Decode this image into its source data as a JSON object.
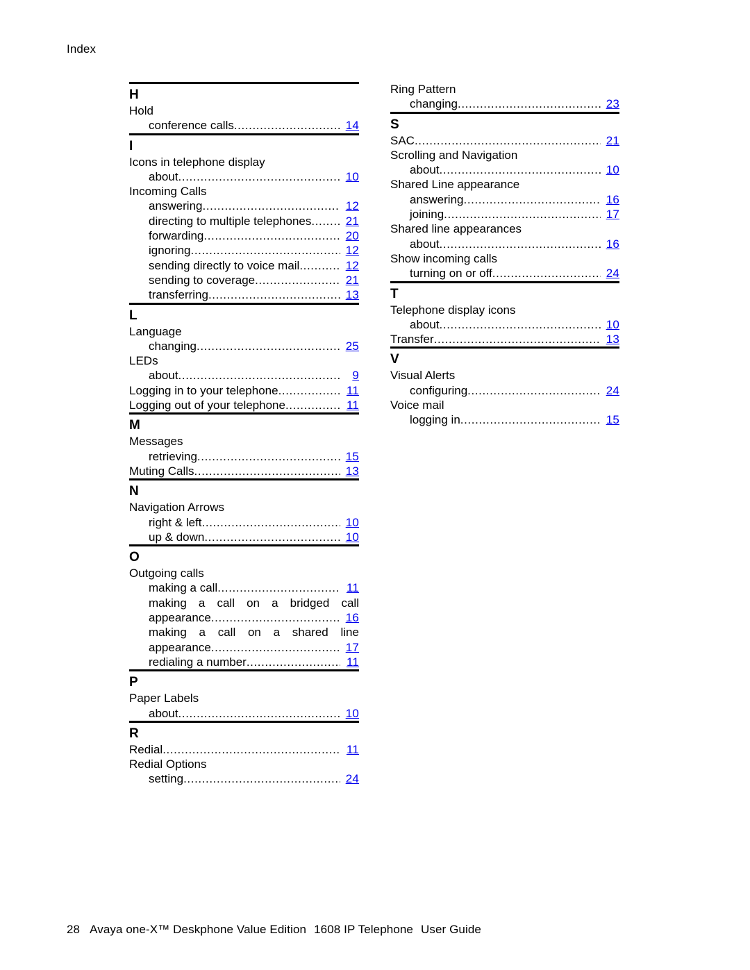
{
  "running_head": "Index",
  "footer": {
    "page_number": "28",
    "product": "Avaya one-X™ Deskphone Value Edition",
    "model": "1608 IP Telephone",
    "doc_type": "User Guide"
  },
  "link_color": "#0000EE",
  "columns": [
    {
      "name": "left-column",
      "sections": [
        {
          "letter": "H",
          "rule_above": true,
          "items": [
            {
              "type": "group",
              "label": "Hold"
            },
            {
              "type": "leader",
              "level": 2,
              "label": "conference calls",
              "page": "14"
            }
          ]
        },
        {
          "letter": "I",
          "rule_above": true,
          "items": [
            {
              "type": "group",
              "label": "Icons in telephone display"
            },
            {
              "type": "leader",
              "level": 2,
              "label": "about",
              "page": "10"
            },
            {
              "type": "group",
              "label": "Incoming Calls"
            },
            {
              "type": "leader",
              "level": 2,
              "label": "answering",
              "page": "12"
            },
            {
              "type": "leader",
              "level": 2,
              "label": "directing to multiple telephones",
              "page": "21"
            },
            {
              "type": "leader",
              "level": 2,
              "label": "forwarding",
              "page": "20"
            },
            {
              "type": "leader",
              "level": 2,
              "label": "ignoring",
              "page": "12"
            },
            {
              "type": "leader",
              "level": 2,
              "label": "sending directly to voice mail",
              "page": "12"
            },
            {
              "type": "leader",
              "level": 2,
              "label": "sending to coverage",
              "page": "21"
            },
            {
              "type": "leader",
              "level": 2,
              "label": "transferring",
              "page": "13"
            }
          ]
        },
        {
          "letter": "L",
          "rule_above": true,
          "items": [
            {
              "type": "group",
              "label": "Language"
            },
            {
              "type": "leader",
              "level": 2,
              "label": "changing",
              "page": "25"
            },
            {
              "type": "group",
              "label": "LEDs"
            },
            {
              "type": "leader",
              "level": 2,
              "label": "about",
              "page": "9"
            },
            {
              "type": "leader",
              "level": 1,
              "label": "Logging in to your telephone",
              "page": "11"
            },
            {
              "type": "leader",
              "level": 1,
              "label": "Logging out of your telephone",
              "page": "11"
            }
          ]
        },
        {
          "letter": "M",
          "rule_above": true,
          "items": [
            {
              "type": "group",
              "label": "Messages"
            },
            {
              "type": "leader",
              "level": 2,
              "label": "retrieving",
              "page": "15"
            },
            {
              "type": "leader",
              "level": 1,
              "label": "Muting Calls",
              "page": "13"
            }
          ]
        },
        {
          "letter": "N",
          "rule_above": true,
          "items": [
            {
              "type": "group",
              "label": "Navigation Arrows"
            },
            {
              "type": "leader",
              "level": 2,
              "label": "right & left",
              "page": "10"
            },
            {
              "type": "leader",
              "level": 2,
              "label": "up & down",
              "page": "10"
            }
          ]
        },
        {
          "letter": "O",
          "rule_above": true,
          "items": [
            {
              "type": "group",
              "label": "Outgoing calls"
            },
            {
              "type": "leader",
              "level": 2,
              "label": "making a call",
              "page": "11"
            },
            {
              "type": "wrap",
              "words": [
                "making",
                "a",
                "call",
                "on",
                "a",
                "bridged",
                "call"
              ]
            },
            {
              "type": "leader",
              "level": 2,
              "label": "appearance",
              "page": "16"
            },
            {
              "type": "wrap",
              "words": [
                "making",
                "a",
                "call",
                "on",
                "a",
                "shared",
                "line"
              ]
            },
            {
              "type": "leader",
              "level": 2,
              "label": "appearance",
              "page": "17"
            },
            {
              "type": "leader",
              "level": 2,
              "label": "redialing a number",
              "page": "11"
            }
          ]
        },
        {
          "letter": "P",
          "rule_above": true,
          "items": [
            {
              "type": "group",
              "label": "Paper Labels"
            },
            {
              "type": "leader",
              "level": 2,
              "label": "about",
              "page": "10"
            }
          ]
        },
        {
          "letter": "R",
          "rule_above": true,
          "items": [
            {
              "type": "leader",
              "level": 1,
              "label": "Redial",
              "page": "11"
            },
            {
              "type": "group",
              "label": "Redial Options"
            },
            {
              "type": "leader",
              "level": 2,
              "label": "setting",
              "page": "24"
            }
          ]
        }
      ]
    },
    {
      "name": "right-column",
      "sections": [
        {
          "letter": "",
          "rule_above": false,
          "items": [
            {
              "type": "group",
              "label": "Ring Pattern"
            },
            {
              "type": "leader",
              "level": 2,
              "label": "changing",
              "page": "23"
            }
          ]
        },
        {
          "letter": "S",
          "rule_above": true,
          "items": [
            {
              "type": "leader",
              "level": 1,
              "label": "SAC",
              "page": "21"
            },
            {
              "type": "group",
              "label": "Scrolling and Navigation"
            },
            {
              "type": "leader",
              "level": 2,
              "label": "about",
              "page": "10"
            },
            {
              "type": "group",
              "label": "Shared Line appearance"
            },
            {
              "type": "leader",
              "level": 2,
              "label": "answering",
              "page": "16"
            },
            {
              "type": "leader",
              "level": 2,
              "label": "joining",
              "page": "17"
            },
            {
              "type": "group",
              "label": "Shared line appearances"
            },
            {
              "type": "leader",
              "level": 2,
              "label": "about",
              "page": "16"
            },
            {
              "type": "group",
              "label": "Show incoming calls"
            },
            {
              "type": "leader",
              "level": 2,
              "label": "turning on or off",
              "page": "24"
            }
          ]
        },
        {
          "letter": "T",
          "rule_above": true,
          "items": [
            {
              "type": "group",
              "label": "Telephone display icons"
            },
            {
              "type": "leader",
              "level": 2,
              "label": "about",
              "page": "10"
            },
            {
              "type": "leader",
              "level": 1,
              "label": "Transfer",
              "page": "13"
            }
          ]
        },
        {
          "letter": "V",
          "rule_above": true,
          "items": [
            {
              "type": "group",
              "label": "Visual Alerts"
            },
            {
              "type": "leader",
              "level": 2,
              "label": "configuring",
              "page": "24"
            },
            {
              "type": "group",
              "label": "Voice mail"
            },
            {
              "type": "leader",
              "level": 2,
              "label": "logging in",
              "page": "15"
            }
          ]
        }
      ]
    }
  ]
}
